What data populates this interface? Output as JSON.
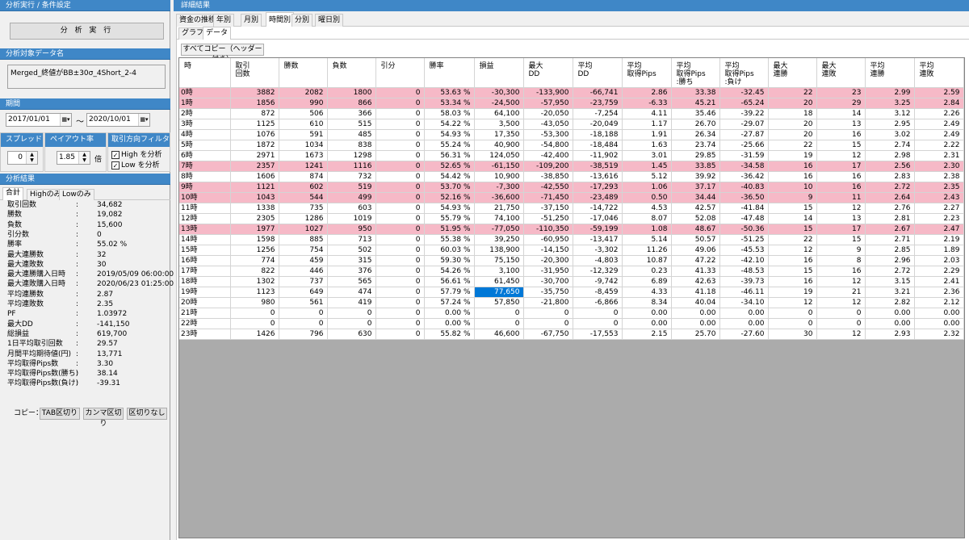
{
  "left": {
    "exec_header": "分析実行 / 条件設定",
    "run_button": "分 析 実 行",
    "target_header": "分析対象データ名",
    "target_name": "Merged_終値がBB±30σ_4Short_2-4",
    "period_header": "期間",
    "date_from": "2017/01/01",
    "date_to": "2020/10/01",
    "date_sep": "〜",
    "spread_header": "スプレッド",
    "spread_value": "0",
    "payout_header": "ペイアウト率",
    "payout_value": "1.85",
    "payout_unit": "倍",
    "filter_header": "取引方向フィルター",
    "filter_high": "High を分析",
    "filter_low": "Low を分析",
    "filter_high_checked": true,
    "filter_low_checked": true,
    "result_header": "分析結果",
    "tabs": [
      "合計",
      "Highのみ",
      "Lowのみ"
    ],
    "results": [
      {
        "k": "取引回数",
        "v": "34,682"
      },
      {
        "k": "勝数",
        "v": "19,082"
      },
      {
        "k": "負数",
        "v": "15,600"
      },
      {
        "k": "引分数",
        "v": "0"
      },
      {
        "k": "勝率",
        "v": "55.02 %"
      },
      {
        "k": "最大連勝数",
        "v": "32"
      },
      {
        "k": "最大連敗数",
        "v": "30"
      },
      {
        "k": "最大連勝購入日時",
        "v": "2019/05/09 06:00:00"
      },
      {
        "k": "最大連敗購入日時",
        "v": "2020/06/23 01:25:00"
      },
      {
        "k": "平均連勝数",
        "v": "2.87"
      },
      {
        "k": "平均連敗数",
        "v": "2.35"
      },
      {
        "k": "PF",
        "v": "1.03972"
      },
      {
        "k": "最大DD",
        "v": "-141,150"
      },
      {
        "k": "総損益",
        "v": "619,700"
      },
      {
        "k": "1日平均取引回数",
        "v": "29.57"
      },
      {
        "k": "月間平均期待値(円)",
        "v": "13,771"
      },
      {
        "k": "平均取得Pips数",
        "v": "3.30"
      },
      {
        "k": "平均取得Pips数(勝ち)",
        "v": "38.14"
      },
      {
        "k": "平均取得Pips数(負け)",
        "v": "-39.31"
      }
    ],
    "colon": ":",
    "copy_label": "コピー：",
    "copy_tab": "TAB区切り",
    "copy_comma": "カンマ区切り",
    "copy_none": "区切りなし"
  },
  "right": {
    "header": "詳細結果",
    "tabs": [
      "資金の推移",
      "年別",
      "月別",
      "時間別",
      "分別",
      "曜日別"
    ],
    "active_tab": 3,
    "subtabs": [
      "グラフ",
      "データ"
    ],
    "active_subtab": 1,
    "copy_all": "すべてコピー（ヘッダー付き）",
    "columns": [
      "時",
      "取引\n回数",
      "勝数",
      "負数",
      "引分",
      "勝率",
      "損益",
      "最大\nDD",
      "平均\nDD",
      "平均\n取得Pips",
      "平均\n取得Pips\n:勝ち",
      "平均\n取得Pips\n:負け",
      "最大\n連勝",
      "最大\n連敗",
      "平均\n連勝",
      "平均\n連敗"
    ],
    "highlight_color": "#f6b9c7",
    "selected_color": "#0078d7",
    "selected_cell": {
      "row": 19,
      "col": 6
    },
    "rows": [
      {
        "h": true,
        "c": [
          "0時",
          "3882",
          "2082",
          "1800",
          "0",
          "53.63 %",
          "-30,300",
          "-133,900",
          "-66,741",
          "2.86",
          "33.38",
          "-32.45",
          "22",
          "23",
          "2.99",
          "2.59"
        ]
      },
      {
        "h": true,
        "c": [
          "1時",
          "1856",
          "990",
          "866",
          "0",
          "53.34 %",
          "-24,500",
          "-57,950",
          "-23,759",
          "-6.33",
          "45.21",
          "-65.24",
          "20",
          "29",
          "3.25",
          "2.84"
        ]
      },
      {
        "h": false,
        "c": [
          "2時",
          "872",
          "506",
          "366",
          "0",
          "58.03 %",
          "64,100",
          "-20,050",
          "-7,254",
          "4.11",
          "35.46",
          "-39.22",
          "18",
          "14",
          "3.12",
          "2.26"
        ]
      },
      {
        "h": false,
        "c": [
          "3時",
          "1125",
          "610",
          "515",
          "0",
          "54.22 %",
          "3,500",
          "-43,050",
          "-20,049",
          "1.17",
          "26.70",
          "-29.07",
          "20",
          "13",
          "2.95",
          "2.49"
        ]
      },
      {
        "h": false,
        "c": [
          "4時",
          "1076",
          "591",
          "485",
          "0",
          "54.93 %",
          "17,350",
          "-53,300",
          "-18,188",
          "1.91",
          "26.34",
          "-27.87",
          "20",
          "16",
          "3.02",
          "2.49"
        ]
      },
      {
        "h": false,
        "c": [
          "5時",
          "1872",
          "1034",
          "838",
          "0",
          "55.24 %",
          "40,900",
          "-54,800",
          "-18,484",
          "1.63",
          "23.74",
          "-25.66",
          "22",
          "15",
          "2.74",
          "2.22"
        ]
      },
      {
        "h": false,
        "c": [
          "6時",
          "2971",
          "1673",
          "1298",
          "0",
          "56.31 %",
          "124,050",
          "-42,400",
          "-11,902",
          "3.01",
          "29.85",
          "-31.59",
          "19",
          "12",
          "2.98",
          "2.31"
        ]
      },
      {
        "h": true,
        "c": [
          "7時",
          "2357",
          "1241",
          "1116",
          "0",
          "52.65 %",
          "-61,150",
          "-109,200",
          "-38,519",
          "1.45",
          "33.85",
          "-34.58",
          "16",
          "17",
          "2.56",
          "2.30"
        ]
      },
      {
        "h": false,
        "c": [
          "8時",
          "1606",
          "874",
          "732",
          "0",
          "54.42 %",
          "10,900",
          "-38,850",
          "-13,616",
          "5.12",
          "39.92",
          "-36.42",
          "16",
          "16",
          "2.83",
          "2.38"
        ]
      },
      {
        "h": true,
        "c": [
          "9時",
          "1121",
          "602",
          "519",
          "0",
          "53.70 %",
          "-7,300",
          "-42,550",
          "-17,293",
          "1.06",
          "37.17",
          "-40.83",
          "10",
          "16",
          "2.72",
          "2.35"
        ]
      },
      {
        "h": true,
        "c": [
          "10時",
          "1043",
          "544",
          "499",
          "0",
          "52.16 %",
          "-36,600",
          "-71,450",
          "-23,489",
          "0.50",
          "34.44",
          "-36.50",
          "9",
          "11",
          "2.64",
          "2.43"
        ]
      },
      {
        "h": false,
        "c": [
          "11時",
          "1338",
          "735",
          "603",
          "0",
          "54.93 %",
          "21,750",
          "-37,150",
          "-14,722",
          "4.53",
          "42.57",
          "-41.84",
          "15",
          "12",
          "2.76",
          "2.27"
        ]
      },
      {
        "h": false,
        "c": [
          "12時",
          "2305",
          "1286",
          "1019",
          "0",
          "55.79 %",
          "74,100",
          "-51,250",
          "-17,046",
          "8.07",
          "52.08",
          "-47.48",
          "14",
          "13",
          "2.81",
          "2.23"
        ]
      },
      {
        "h": true,
        "c": [
          "13時",
          "1977",
          "1027",
          "950",
          "0",
          "51.95 %",
          "-77,050",
          "-110,350",
          "-59,199",
          "1.08",
          "48.67",
          "-50.36",
          "15",
          "17",
          "2.67",
          "2.47"
        ]
      },
      {
        "h": false,
        "c": [
          "14時",
          "1598",
          "885",
          "713",
          "0",
          "55.38 %",
          "39,250",
          "-60,950",
          "-13,417",
          "5.14",
          "50.57",
          "-51.25",
          "22",
          "15",
          "2.71",
          "2.19"
        ]
      },
      {
        "h": false,
        "c": [
          "15時",
          "1256",
          "754",
          "502",
          "0",
          "60.03 %",
          "138,900",
          "-14,150",
          "-3,302",
          "11.26",
          "49.06",
          "-45.53",
          "12",
          "9",
          "2.85",
          "1.89"
        ]
      },
      {
        "h": false,
        "c": [
          "16時",
          "774",
          "459",
          "315",
          "0",
          "59.30 %",
          "75,150",
          "-20,300",
          "-4,803",
          "10.87",
          "47.22",
          "-42.10",
          "16",
          "8",
          "2.96",
          "2.03"
        ]
      },
      {
        "h": false,
        "c": [
          "17時",
          "822",
          "446",
          "376",
          "0",
          "54.26 %",
          "3,100",
          "-31,950",
          "-12,329",
          "0.23",
          "41.33",
          "-48.53",
          "15",
          "16",
          "2.72",
          "2.29"
        ]
      },
      {
        "h": false,
        "c": [
          "18時",
          "1302",
          "737",
          "565",
          "0",
          "56.61 %",
          "61,450",
          "-30,700",
          "-9,742",
          "6.89",
          "42.63",
          "-39.73",
          "16",
          "12",
          "3.15",
          "2.41"
        ]
      },
      {
        "h": false,
        "c": [
          "19時",
          "1123",
          "649",
          "474",
          "0",
          "57.79 %",
          "77,650",
          "-35,750",
          "-8,459",
          "4.33",
          "41.18",
          "-46.11",
          "19",
          "21",
          "3.21",
          "2.36"
        ]
      },
      {
        "h": false,
        "c": [
          "20時",
          "980",
          "561",
          "419",
          "0",
          "57.24 %",
          "57,850",
          "-21,800",
          "-6,866",
          "8.34",
          "40.04",
          "-34.10",
          "12",
          "12",
          "2.82",
          "2.12"
        ]
      },
      {
        "h": false,
        "c": [
          "21時",
          "0",
          "0",
          "0",
          "0",
          "0.00 %",
          "0",
          "0",
          "0",
          "0.00",
          "0.00",
          "0.00",
          "0",
          "0",
          "0.00",
          "0.00"
        ]
      },
      {
        "h": false,
        "c": [
          "22時",
          "0",
          "0",
          "0",
          "0",
          "0.00 %",
          "0",
          "0",
          "0",
          "0.00",
          "0.00",
          "0.00",
          "0",
          "0",
          "0.00",
          "0.00"
        ]
      },
      {
        "h": false,
        "c": [
          "23時",
          "1426",
          "796",
          "630",
          "0",
          "55.82 %",
          "46,600",
          "-67,750",
          "-17,553",
          "2.15",
          "25.70",
          "-27.60",
          "30",
          "12",
          "2.93",
          "2.32"
        ]
      }
    ]
  }
}
